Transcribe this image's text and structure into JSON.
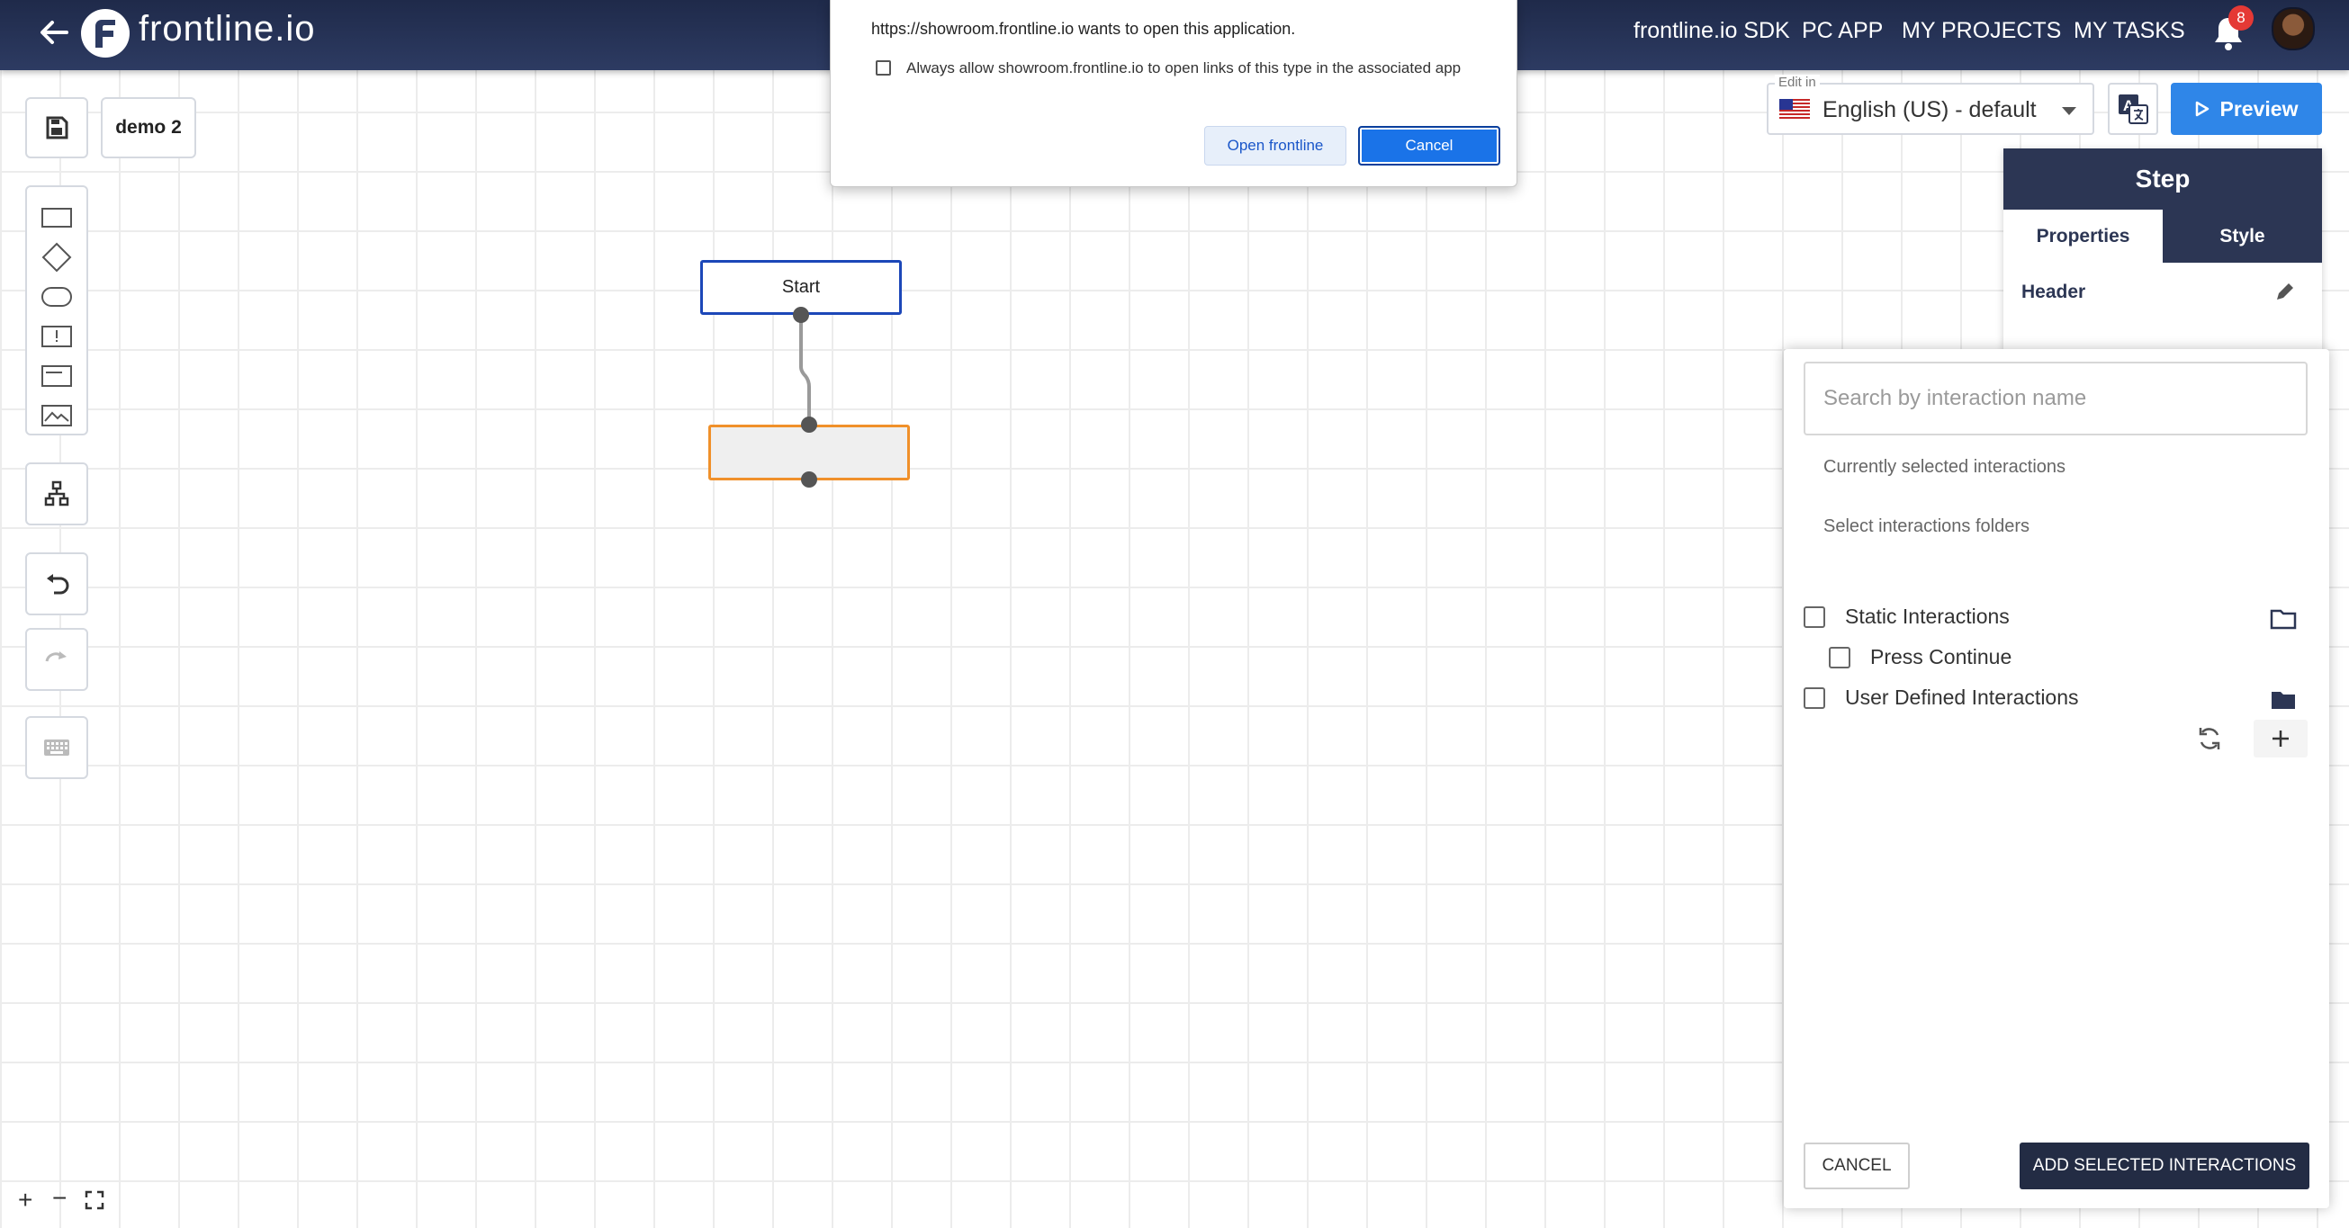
{
  "header": {
    "logo_text": "frontline.io",
    "nav": {
      "sdk": "frontline.io SDK",
      "pc_app": "PC APP",
      "my_projects": "MY PROJECTS",
      "my_tasks": "MY TASKS"
    },
    "notification_count": "8"
  },
  "editor": {
    "document_name": "demo 2",
    "nodes": {
      "start_label": "Start"
    }
  },
  "dialog": {
    "message": "https://showroom.frontline.io wants to open this application.",
    "checkbox_label": "Always allow showroom.frontline.io to open links of this type in the associated app",
    "open_button": "Open frontline",
    "cancel_button": "Cancel"
  },
  "language": {
    "caption": "Edit in",
    "selected": "English (US) - default"
  },
  "preview_label": "Preview",
  "step_panel": {
    "title": "Step",
    "tabs": {
      "properties": "Properties",
      "style": "Style"
    },
    "header_label": "Header"
  },
  "interactions": {
    "search_placeholder": "Search by interaction name",
    "currently_selected": "Currently selected interactions",
    "select_folders": "Select interactions folders",
    "tree": {
      "static": "Static Interactions",
      "press_continue": "Press Continue",
      "user_defined": "User Defined Interactions"
    },
    "cancel": "CANCEL",
    "add_selected": "ADD SELECTED INTERACTIONS"
  },
  "colors": {
    "header_bg": "#2d3b62",
    "start_node_border": "#1c47b8",
    "selected_node_border": "#f0902a",
    "preview_button": "#2f86e8",
    "panel_dark": "#2c3654"
  }
}
